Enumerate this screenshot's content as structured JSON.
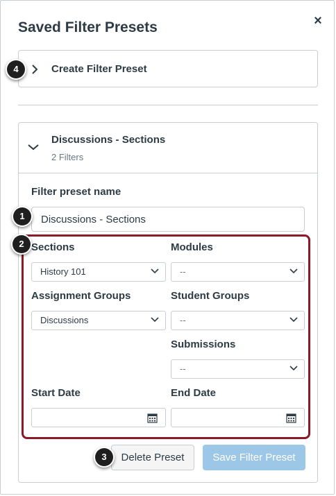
{
  "tray": {
    "title": "Saved Filter Presets",
    "close_icon": "×"
  },
  "create": {
    "label": "Create Filter Preset"
  },
  "preset": {
    "title": "Discussions - Sections",
    "subtitle": "2 Filters",
    "name_label": "Filter preset name",
    "name_value": "Discussions - Sections"
  },
  "filters": {
    "sections": {
      "label": "Sections",
      "value": "History 101"
    },
    "modules": {
      "label": "Modules",
      "value": "--"
    },
    "assignment_groups": {
      "label": "Assignment Groups",
      "value": "Discussions"
    },
    "student_groups": {
      "label": "Student Groups",
      "value": "--"
    },
    "submissions": {
      "label": "Submissions",
      "value": "--"
    },
    "start_date": {
      "label": "Start Date",
      "value": ""
    },
    "end_date": {
      "label": "End Date",
      "value": ""
    }
  },
  "buttons": {
    "delete": "Delete Preset",
    "save": "Save Filter Preset"
  },
  "badges": [
    "1",
    "2",
    "3",
    "4"
  ],
  "colors": {
    "highlight_frame": "#8b1a26",
    "save_button": "#9cc7e6",
    "text": "#2d3b45"
  }
}
